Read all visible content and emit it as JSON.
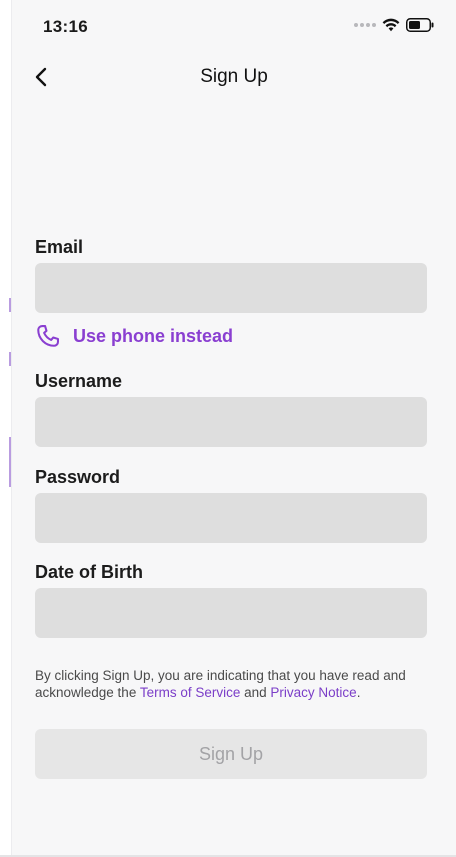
{
  "status_bar": {
    "time": "13:16"
  },
  "nav": {
    "title": "Sign Up"
  },
  "form": {
    "email_label": "Email",
    "email_value": "",
    "use_phone_label": "Use phone instead",
    "username_label": "Username",
    "username_value": "",
    "password_label": "Password",
    "password_value": "",
    "dob_label": "Date of Birth",
    "dob_value": ""
  },
  "legal": {
    "prefix": "By clicking Sign Up, you are indicating that you have read and acknowledge the ",
    "terms_link": "Terms of Service",
    "middle": " and ",
    "privacy_link": "Privacy Notice",
    "suffix": "."
  },
  "submit": {
    "label": "Sign Up"
  },
  "colors": {
    "accent": "#8a3fd1",
    "link": "#7b3ec8",
    "input_bg": "#dedede",
    "button_disabled_bg": "#e6e6e6",
    "button_disabled_text": "#a3a3a6"
  },
  "icons": [
    "chevron-left-icon",
    "phone-icon",
    "wifi-icon",
    "battery-icon",
    "signal-icon"
  ]
}
